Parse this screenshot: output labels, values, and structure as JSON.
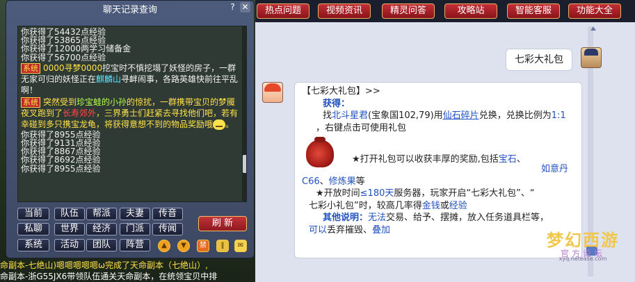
{
  "chat_window": {
    "title": "聊天记录查询",
    "help": "?",
    "close": "✕",
    "log": {
      "l1": "你获得了54432点经验",
      "l2": "你获得了53865点经验",
      "l3": "你获得了12000两学习储备金",
      "l4": "你获得了56700点经验",
      "w1_tag": "系统",
      "w1_name": "0000寻梦0000",
      "w1_text": "挖宝时不慎挖塌了妖怪的房子，一群无家可归的妖怪正在",
      "w1_place": "麒麟山",
      "w1_text2": "寻衅闹事，各路英雄快前往平乱啊！",
      "w2_tag": "系统",
      "w2_text": "突然受到",
      "w2_name": "珍宝蛙的小孙",
      "w2_text2": "的惊扰，一群携带宝贝的梦魇夜叉跑到了",
      "w2_place": "长寿郊外",
      "w2_text3": "，三界勇士们赶紧去寻找他们吧，若有幸碰到多只携宝龙龟，将获得意想不到的物品奖励哦",
      "w2_end": "。",
      "l5": "你获得了8955点经验",
      "l6": "你获得了9131点经验",
      "l7": "你获得了8867点经验",
      "l8": "你获得了8692点经验",
      "l9": "你获得了8955点经验"
    },
    "channels": {
      "r1": [
        "当前",
        "队伍",
        "帮派",
        "夫妻",
        "传音"
      ],
      "r2": [
        "私聊",
        "世界",
        "经济",
        "门派",
        "传闻"
      ],
      "r3": [
        "系统",
        "活动",
        "团队",
        "阵营"
      ]
    },
    "refresh": "刷 新",
    "icons": {
      "up": "up-icon",
      "down": "down-icon",
      "ban": "禁",
      "pause": "pause-icon",
      "mail": "mail-icon"
    }
  },
  "bottom_chat": {
    "line1": "命副本-七绝山)嗯嗯嗯嗯嗯ω完成了天命副本（七绝山）,",
    "line2": "命副本-浙G55JX6带领队伍通关天命副本，在统领宝贝中排"
  },
  "nav": {
    "items": [
      "热点问题",
      "视频资讯",
      "精灵问答",
      "攻略站",
      "智能客服",
      "功能大全"
    ]
  },
  "conversation": {
    "user_message": "七彩大礼包",
    "bot": {
      "title": "【七彩大礼包】>>",
      "obtain_label": "获得：",
      "find": "找",
      "npc": "北斗星君",
      "npc_loc": "(宝象国102,79)用",
      "item": "仙石碎片",
      "exchange": "兑换，兑换比例为",
      "ratio": "1:1",
      "use": "，右键点击可使用礼包",
      "effect_lead": "★打开礼包可以收获丰厚的奖励,包括",
      "r1": "宝石",
      "sep1": "、",
      "r2": "如意丹C66",
      "sep2": "、",
      "r3": "修炼果",
      "etc": "等",
      "time_lead": "★开放时间",
      "days": "≤180天",
      "time_text": "服务器，玩家开启“七彩大礼包”、“七彩小礼包”时，较高几率得",
      "money": "金钱",
      "or": "或",
      "exp": "经验",
      "other_label": "其他说明：",
      "no_trade": "无法",
      "other_text": "交易、给予、摆摊，放入任务道具栏等，",
      "can": "可以",
      "discard": "丢弃摧毁、",
      "stack": "叠加"
    }
  },
  "logo": {
    "main": "梦幻西游",
    "sub": "官方论坛",
    "url": "xyq.netease.com"
  },
  "colors": {
    "accent_red": "#c22f36",
    "link_blue": "#2050c0",
    "sys_yellow": "#ffe24a"
  }
}
